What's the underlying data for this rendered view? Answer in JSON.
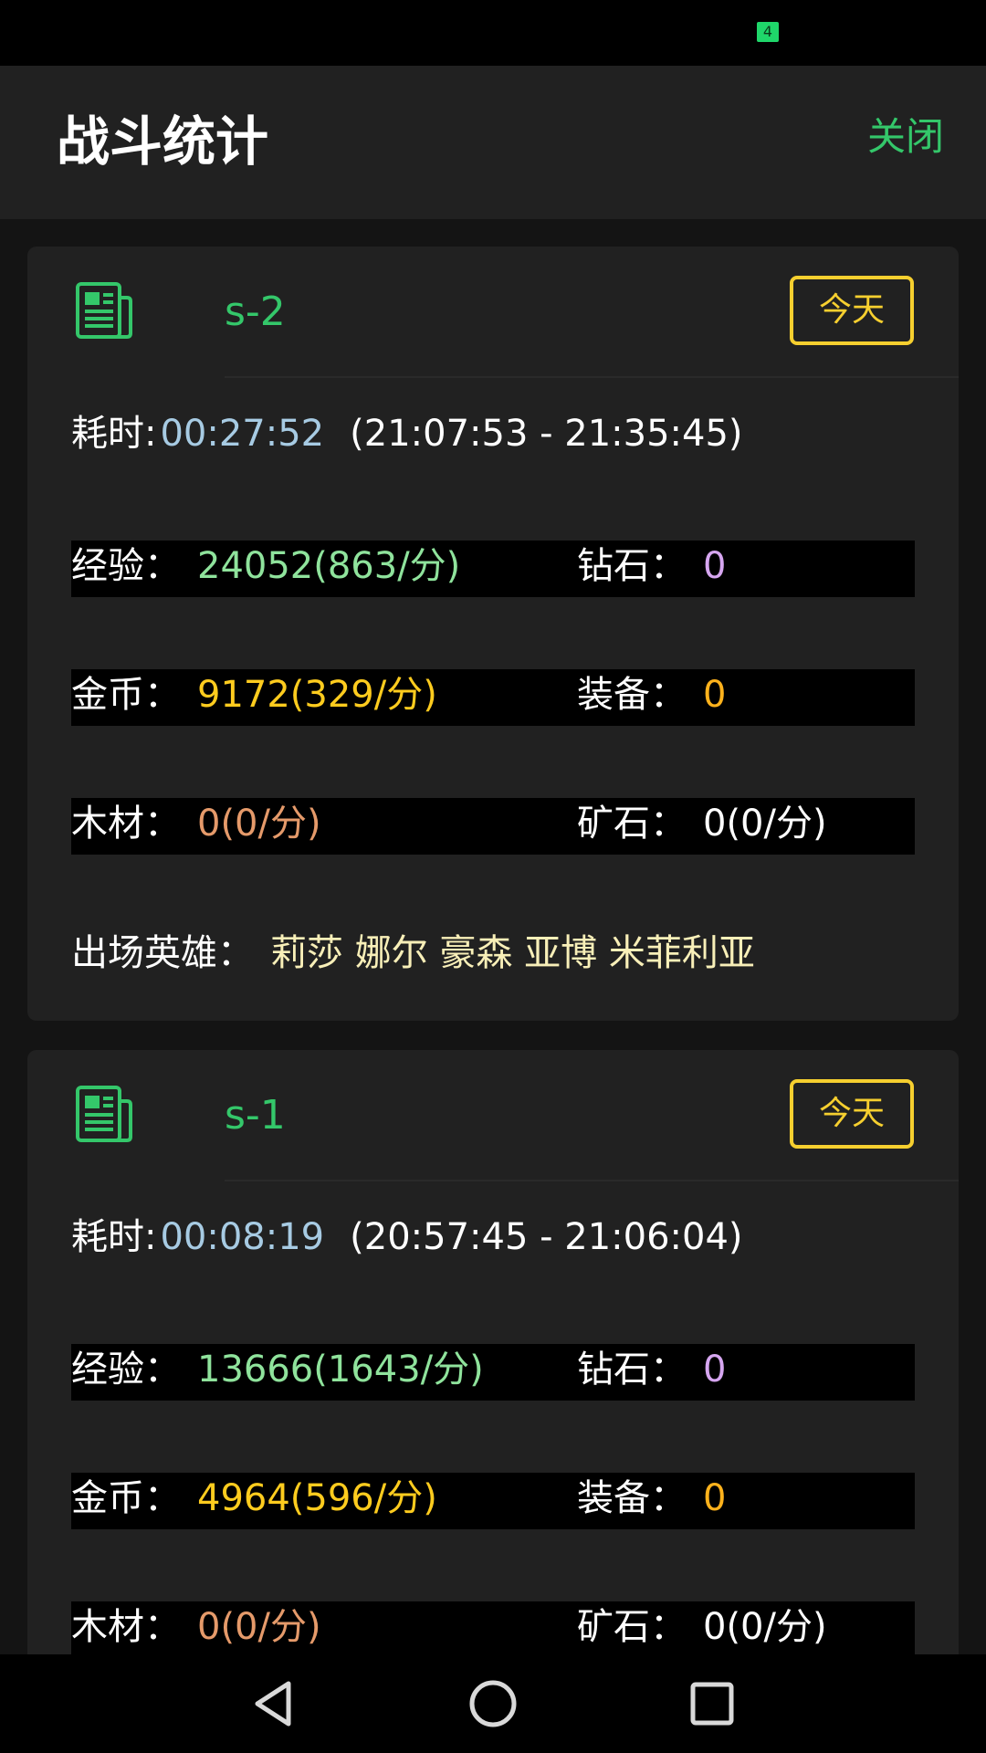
{
  "status_bar": {
    "battery_level": "4",
    "battery_color": "#1fd66a"
  },
  "header": {
    "title": "战斗统计",
    "close_label": "关闭"
  },
  "colors": {
    "accent_green": "#34c76a",
    "badge_yellow": "#f6cf2f",
    "duration_blue": "#a7cbe3",
    "exp_green": "#8fe39c",
    "diamond_purple": "#d6a6f0",
    "gold_yellow": "#ffcc1e",
    "equip_orange": "#ffb21c",
    "wood_orange": "#e59a6a",
    "hero_cream": "#f8efb8"
  },
  "battles": [
    {
      "id": "s-2",
      "date_badge": "今天",
      "duration_label": "耗时:",
      "duration": "00:27:52",
      "time_range": "(21:07:53 - 21:35:45)",
      "exp_label": "经验：",
      "exp": "24052(863/分)",
      "diamond_label": "钻石：",
      "diamond": "0",
      "gold_label": "金币：",
      "gold": "9172(329/分)",
      "equip_label": "装备：",
      "equip": "0",
      "wood_label": "木材：",
      "wood": "0(0/分)",
      "ore_label": "矿石：",
      "ore": "0(0/分)",
      "heroes_label": "出场英雄：",
      "heroes": "莉莎 娜尔 豪森 亚博 米菲利亚"
    },
    {
      "id": "s-1",
      "date_badge": "今天",
      "duration_label": "耗时:",
      "duration": "00:08:19",
      "time_range": "(20:57:45 - 21:06:04)",
      "exp_label": "经验：",
      "exp": "13666(1643/分)",
      "diamond_label": "钻石：",
      "diamond": "0",
      "gold_label": "金币：",
      "gold": "4964(596/分)",
      "equip_label": "装备：",
      "equip": "0",
      "wood_label": "木材：",
      "wood": "0(0/分)",
      "ore_label": "矿石：",
      "ore": "0(0/分)"
    }
  ],
  "nav": {
    "back_icon": "back-triangle-icon",
    "home_icon": "home-circle-icon",
    "recents_icon": "recents-square-icon"
  }
}
